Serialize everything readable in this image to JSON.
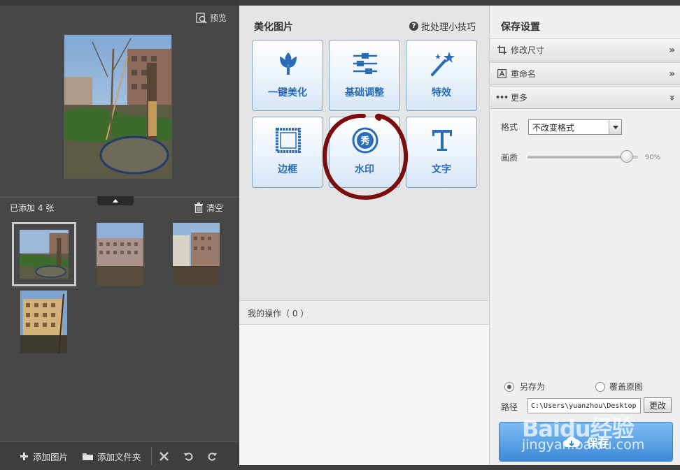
{
  "left_panel": {
    "preview_label": "预览",
    "added_count_label": "已添加 4 张",
    "clear_label": "清空",
    "toolbar": {
      "add_image_label": "添加图片",
      "add_folder_label": "添加文件夹"
    }
  },
  "middle_panel": {
    "title": "美化图片",
    "tips_label": "批处理小技巧",
    "tools": [
      {
        "label": "一键美化",
        "icon": "tulip-icon"
      },
      {
        "label": "基础调整",
        "icon": "sliders-icon"
      },
      {
        "label": "特效",
        "icon": "magic-wand-icon"
      },
      {
        "label": "边框",
        "icon": "frame-icon"
      },
      {
        "label": "水印",
        "icon": "watermark-seal-icon"
      },
      {
        "label": "文字",
        "icon": "text-t-icon"
      }
    ],
    "operations_label": "我的操作（ 0 ）"
  },
  "right_panel": {
    "title": "保存设置",
    "sections": {
      "resize": "修改尺寸",
      "rename": "重命名",
      "more": "更多"
    },
    "format_label": "格式",
    "format_value": "不改变格式",
    "quality_label": "画质",
    "quality_value": "90%",
    "quality_fraction": 0.9,
    "save_as_label": "另存为",
    "overwrite_label": "覆盖原图",
    "path_label": "路径",
    "path_value": "C:\\Users\\yuanzhou\\Desktop",
    "change_label": "更改",
    "save_label": "保存"
  },
  "watermark": {
    "logo": "Baidu经验",
    "url": "jingyan.baidu.com"
  },
  "colors": {
    "accent": "#2a6db6",
    "save_button": "#4a94dd",
    "annotation": "#7a0d0d"
  }
}
